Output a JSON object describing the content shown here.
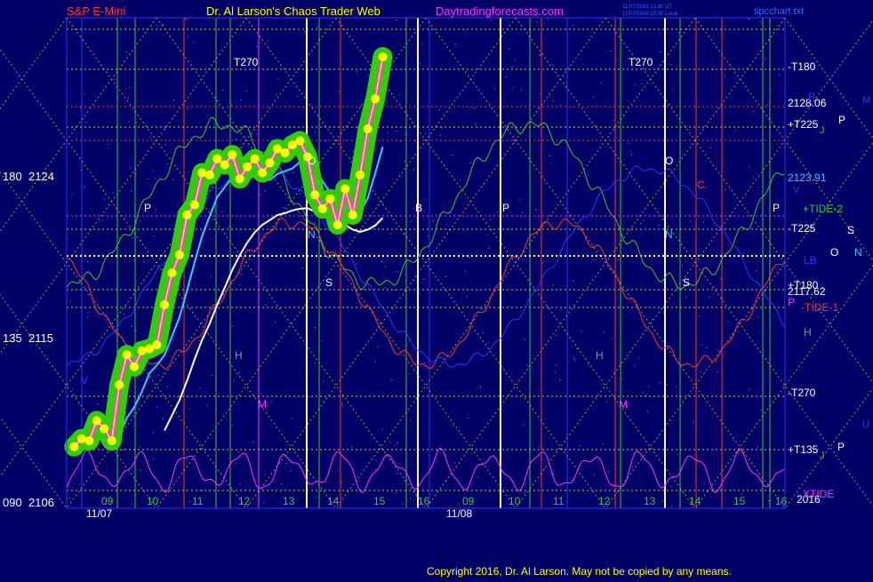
{
  "header": {
    "instrument": "S&P E-Mini",
    "author_title": "Dr. Al Larson's Chaos Trader Web",
    "site": "Daytradingforecasts.com",
    "timestamp_line1": "11/07/2016 21:30 UT",
    "timestamp_line2": "11/07/2016 15:30 Local",
    "file": "spcchart.txt"
  },
  "footer": {
    "copyright": "Copyright 2016, Dr. Al Larson. May not be copied by any means."
  },
  "colors": {
    "background": "#000066",
    "price_highlight": "#33cc00",
    "price_dots": "#ffff00",
    "price_trace": "#ff33ff",
    "moving_average_fast": "#33ccff",
    "moving_average_slow": "#ffffff",
    "green_tide": "#33cc33",
    "red_tide": "#ff3333",
    "blue_tide": "#3333ff",
    "magenta_tide": "#ff33ff",
    "grid_yellow": "#cccc33",
    "grid_white": "#ffffff"
  },
  "chart_data": {
    "type": "line",
    "title": "S&P E-Mini",
    "y_axis_labels": [
      {
        "angle": "180",
        "price": "2124"
      },
      {
        "angle": "135",
        "price": "2115"
      },
      {
        "angle": "090",
        "price": "2106"
      }
    ],
    "ylim": [
      2106,
      2130
    ],
    "x_tick_labels": [
      "09",
      "10",
      "11",
      "12",
      "13",
      "14",
      "15",
      "16",
      "09",
      "10",
      "11",
      "12",
      "13",
      "14",
      "15",
      "16"
    ],
    "date_labels": [
      "11/07",
      "11/08"
    ],
    "price_labels_right": [
      "2128.06",
      "2123.91",
      "2117.62",
      "2016"
    ],
    "right_labels": [
      "-T180",
      "+T225",
      "+TIDE-2",
      "-T225",
      "+T180",
      "-TIDE-1",
      "-T270",
      "+T135",
      "XTIDE"
    ],
    "time_labels_top": [
      "T270",
      "T270"
    ],
    "side_letters": [
      "P",
      "P",
      "M",
      "P",
      "J",
      "S",
      "O",
      "N",
      "LB",
      "H",
      "U",
      "P",
      "J",
      "V"
    ],
    "chart_letters": [
      "P",
      "O",
      "N",
      "S",
      "H",
      "M",
      "B",
      "P",
      "O",
      "C",
      "N",
      "S",
      "H",
      "M",
      "P",
      "V"
    ],
    "series": [
      {
        "name": "S&P E-Mini",
        "x": [
          "08:40",
          "08:50",
          "09:00",
          "09:10",
          "09:20",
          "09:30",
          "09:40",
          "09:50",
          "10:00",
          "10:10",
          "10:20",
          "10:30",
          "10:40",
          "10:50",
          "11:00",
          "11:10",
          "11:20",
          "11:30",
          "11:40",
          "11:50",
          "12:00",
          "12:10",
          "12:20",
          "12:30",
          "12:40",
          "12:50",
          "13:00",
          "13:10",
          "13:20",
          "13:30",
          "13:40",
          "13:50",
          "14:00",
          "14:10",
          "14:20",
          "14:30",
          "14:40",
          "14:50",
          "15:00",
          "15:10",
          "15:20",
          "15:30"
        ],
        "values": [
          2108.9,
          2109.3,
          2109.2,
          2110.2,
          2109.8,
          2109.2,
          2112.0,
          2113.5,
          2112.9,
          2113.7,
          2113.8,
          2114.0,
          2116.0,
          2117.6,
          2118.5,
          2120.5,
          2121.0,
          2122.6,
          2122.5,
          2123.3,
          2123.0,
          2123.5,
          2122.3,
          2122.9,
          2123.3,
          2122.6,
          2123.1,
          2123.8,
          2123.6,
          2124.0,
          2124.2,
          2123.4,
          2121.5,
          2120.8,
          2121.3,
          2120.0,
          2121.8,
          2120.5,
          2122.5,
          2124.8,
          2126.3,
          2128.4
        ]
      }
    ]
  }
}
